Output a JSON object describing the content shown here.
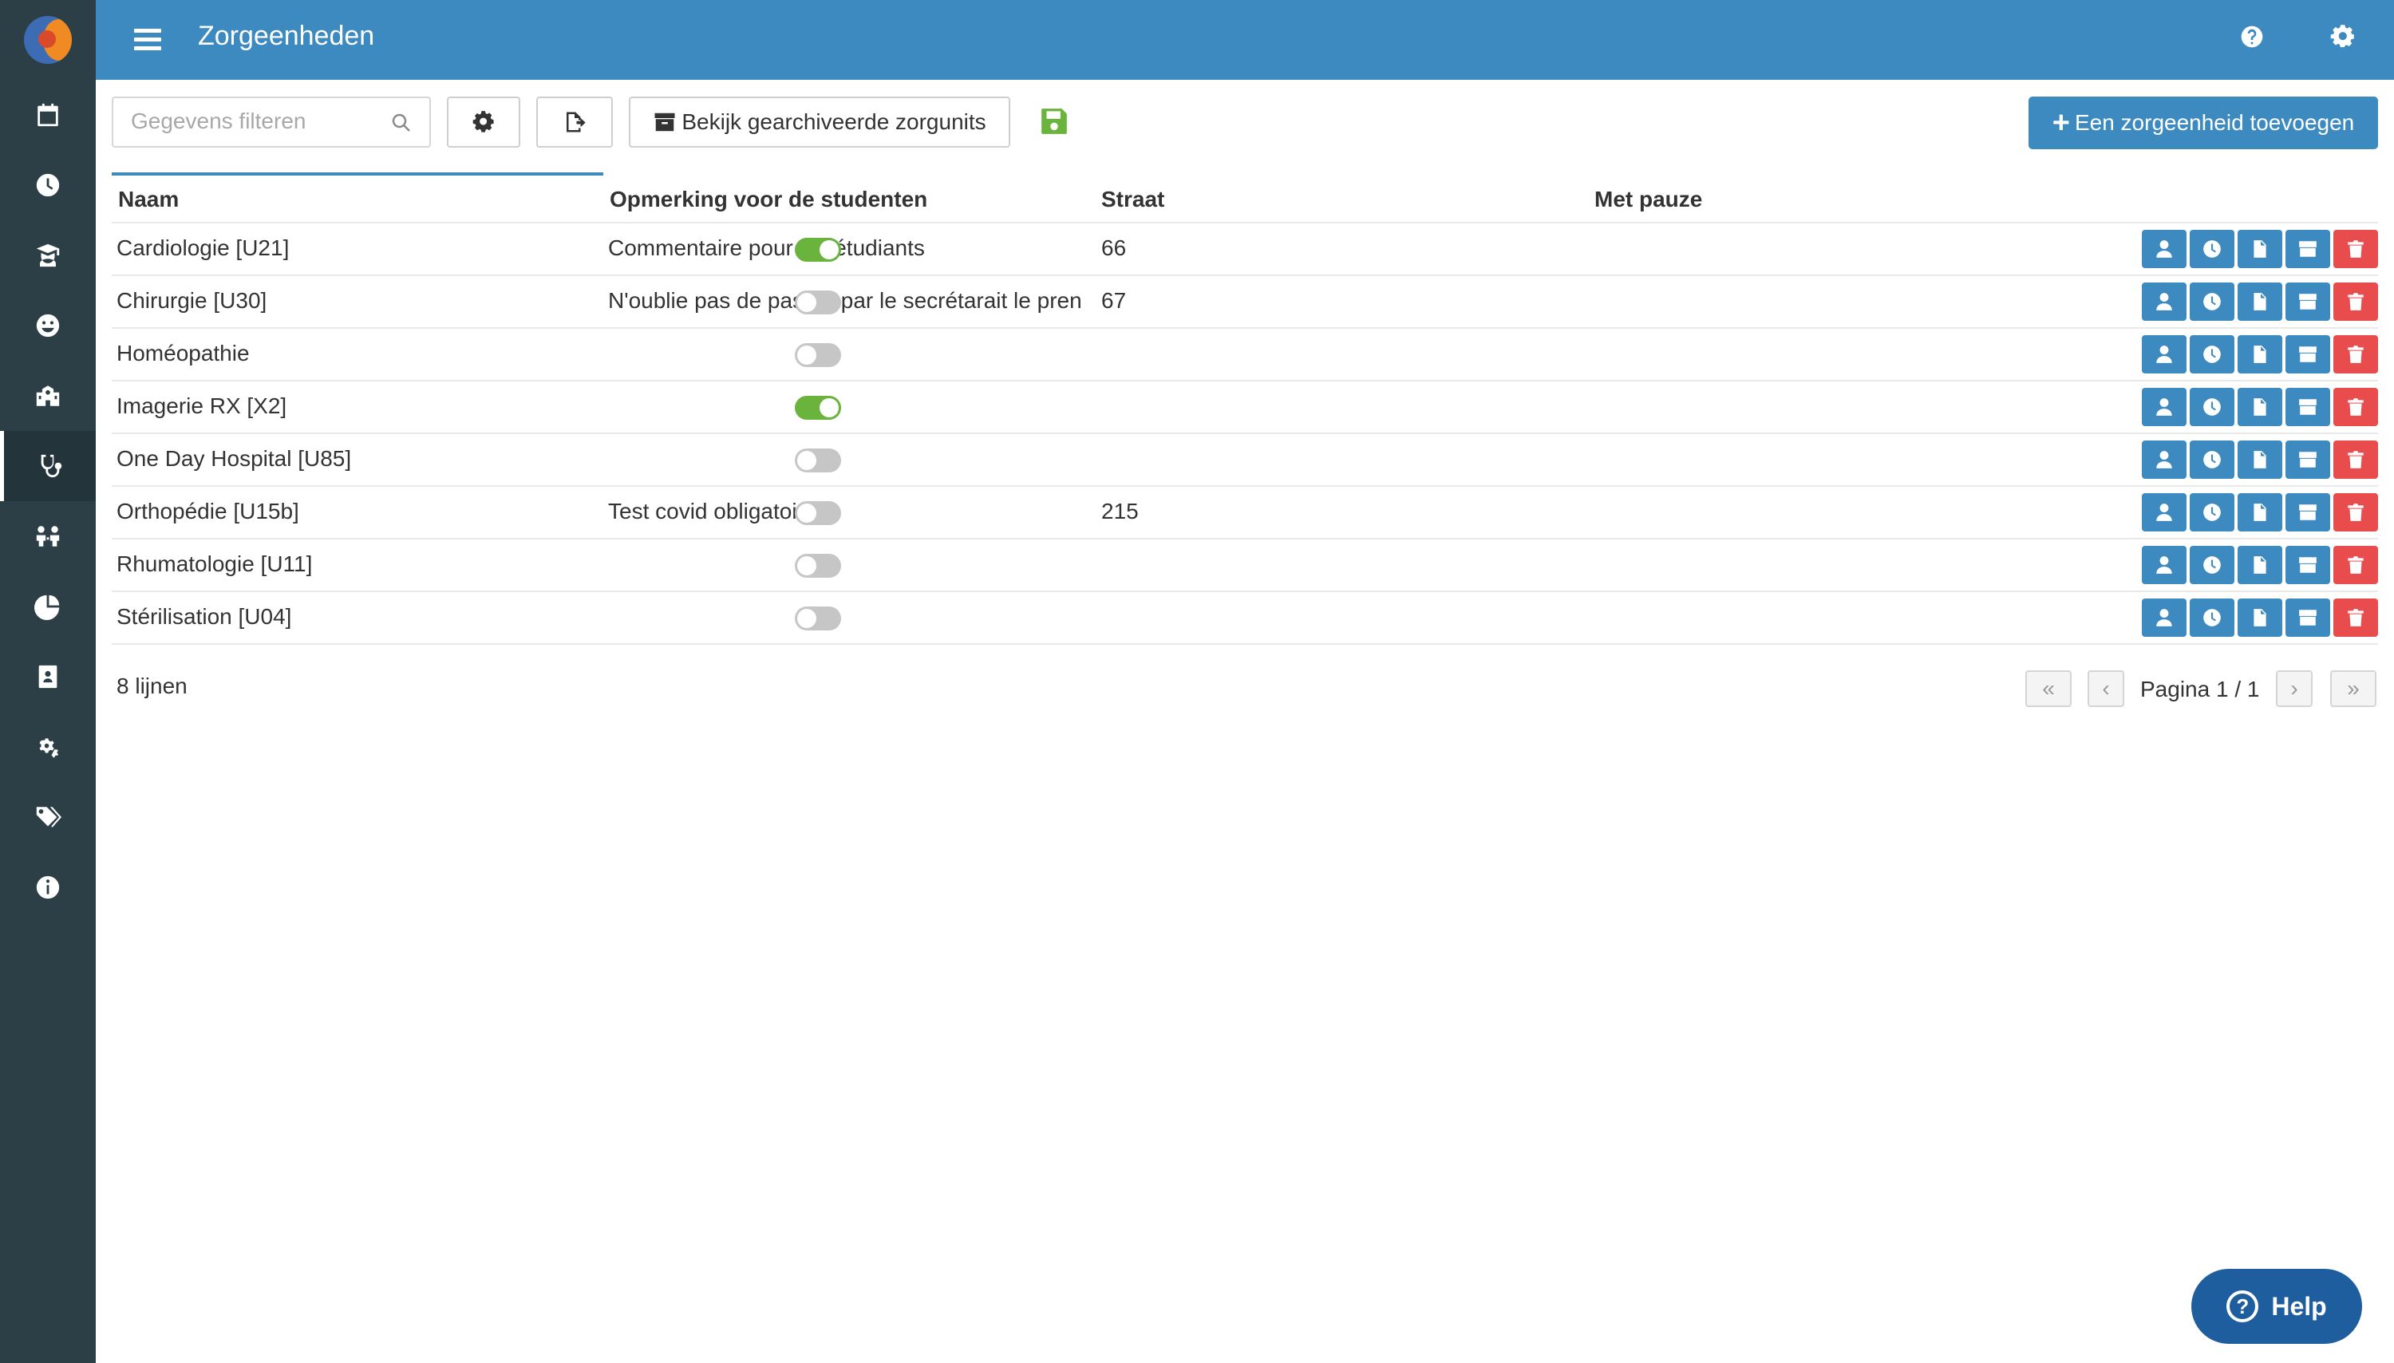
{
  "header": {
    "title": "Zorgeenheden"
  },
  "toolbar": {
    "search_placeholder": "Gegevens filteren",
    "archive_label": "Bekijk gearchiveerde zorgunits",
    "add_label": "Een zorgeenheid toevoegen"
  },
  "sidebar": {
    "items": [
      {
        "icon": "calendar-icon"
      },
      {
        "icon": "clock-icon"
      },
      {
        "icon": "graduate-icon"
      },
      {
        "icon": "smile-icon"
      },
      {
        "icon": "school-icon"
      },
      {
        "icon": "stethoscope-icon",
        "active": true
      },
      {
        "icon": "people-icon"
      },
      {
        "icon": "pie-chart-icon"
      },
      {
        "icon": "contact-card-icon"
      },
      {
        "icon": "gears-icon"
      },
      {
        "icon": "tags-icon"
      },
      {
        "icon": "info-icon"
      }
    ]
  },
  "table": {
    "columns": [
      "Naam",
      "Opmerking voor de studenten",
      "Straat",
      "Met pauze"
    ],
    "rows": [
      {
        "name": "Cardiologie [U21]",
        "remark": "Commentaire pour les étudiants",
        "street": "66",
        "pause": true
      },
      {
        "name": "Chirurgie [U30]",
        "remark": "N'oublie pas de passer par le secrétarait le pren",
        "street": "67",
        "pause": false
      },
      {
        "name": "Homéopathie",
        "remark": "",
        "street": "",
        "pause": false
      },
      {
        "name": "Imagerie RX [X2]",
        "remark": "",
        "street": "",
        "pause": true
      },
      {
        "name": "One Day Hospital [U85]",
        "remark": "",
        "street": "",
        "pause": false
      },
      {
        "name": "Orthopédie [U15b]",
        "remark": "Test covid obligatoire",
        "street": "215",
        "pause": false
      },
      {
        "name": "Rhumatologie [U11]",
        "remark": "",
        "street": "",
        "pause": false
      },
      {
        "name": "Stérilisation [U04]",
        "remark": "",
        "street": "",
        "pause": false
      }
    ],
    "row_actions": [
      "person-icon",
      "clock-icon",
      "document-icon",
      "archive-icon",
      "trash-icon"
    ]
  },
  "footer": {
    "line_count": "8 lijnen",
    "page_info": "Pagina 1 / 1"
  },
  "help": {
    "label": "Help"
  },
  "colors": {
    "header": "#3d8ac0",
    "sidebar": "#2c3e46",
    "toggle_on": "#6ab33d",
    "delete": "#e84c4c",
    "save_icon": "#6ab33d"
  }
}
